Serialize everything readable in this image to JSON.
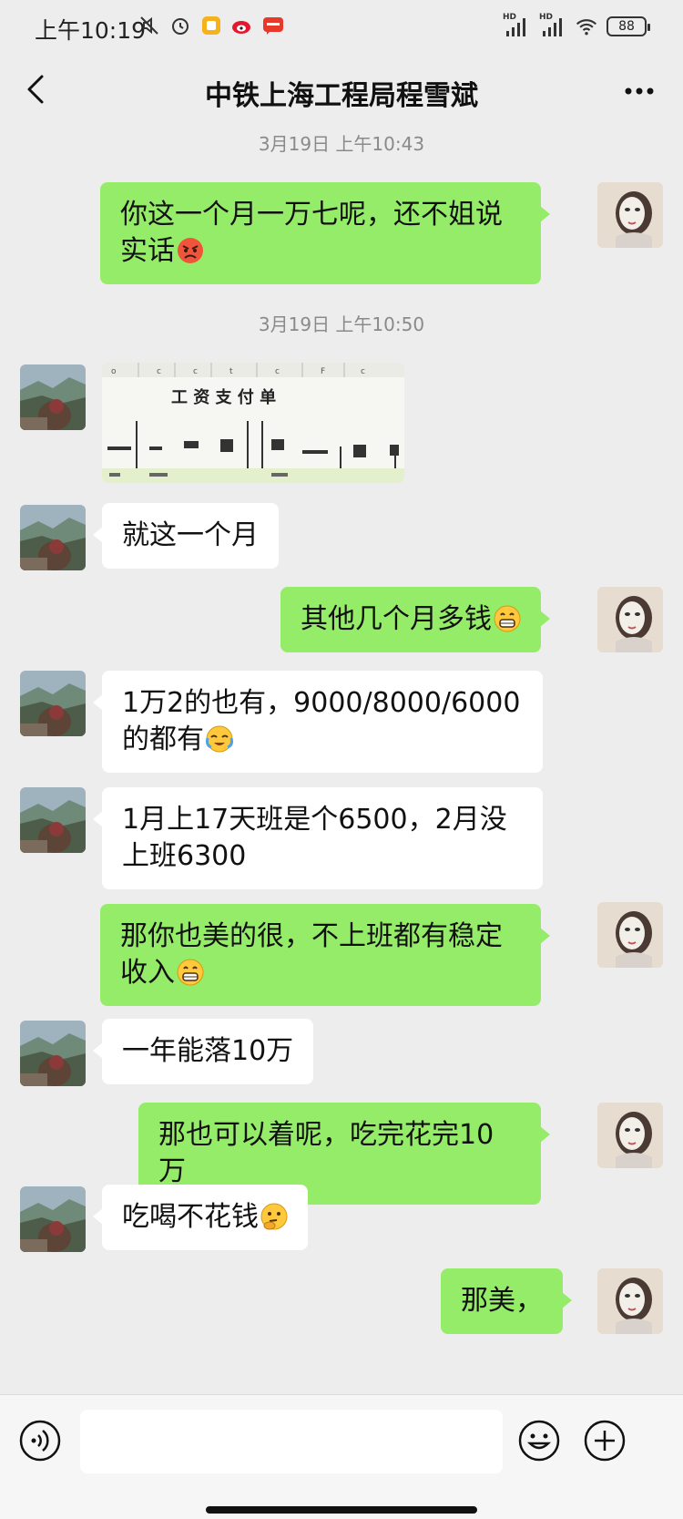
{
  "status_bar": {
    "time": "上午10:19",
    "battery": "88",
    "icons": [
      "mute-icon",
      "alarm-icon",
      "notes-icon",
      "weibo-icon",
      "app-icon",
      "signal-hd-icon",
      "signal-hd-icon",
      "wifi-icon",
      "battery-icon"
    ]
  },
  "header": {
    "title": "中铁上海工程局程雪斌",
    "back_icon": "back-chevron-icon",
    "more_icon": "more-dots-icon"
  },
  "messages": {
    "ts1": "3月19日 上午10:43",
    "m1": "你这一个月一万七呢，还不姐说实话",
    "ts2": "3月19日 上午10:50",
    "img_title": "工 资 支 付 单",
    "m3": "就这一个月",
    "m4": "其他几个月多钱",
    "m5": "1万2的也有，9000/8000/6000的都有",
    "m6": "1月上17天班是个6500，2月没上班6300",
    "m7": "那你也美的很，不上班都有稳定收入",
    "m8": "一年能落10万",
    "m9": "那也可以着呢，吃完花完10万",
    "m10": "吃喝不花钱",
    "m11": "那美，"
  },
  "input_bar": {
    "placeholder": "",
    "icons": [
      "voice-icon",
      "emoji-icon",
      "plus-icon"
    ]
  },
  "colors": {
    "background": "#ededed",
    "my_bubble": "#95ec69",
    "other_bubble": "#ffffff",
    "timestamp": "#8a8a8a"
  }
}
